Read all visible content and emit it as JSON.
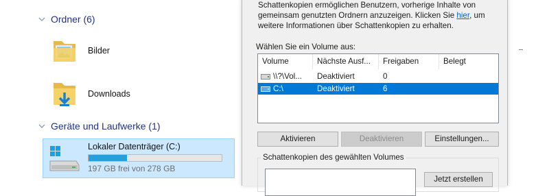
{
  "explorer": {
    "groups": [
      {
        "label": "Ordner (6)"
      },
      {
        "label": "Geräte und Laufwerke (1)"
      }
    ],
    "folders": [
      {
        "name": "Bilder",
        "icon": "pictures-folder-icon"
      },
      {
        "name": "Downloads",
        "icon": "downloads-folder-icon"
      }
    ],
    "drive": {
      "name": "Lokaler Datenträger (C:)",
      "free_text": "197 GB frei von 278 GB",
      "used_fraction": 0.29,
      "icon": "windows-drive-icon"
    }
  },
  "dialog": {
    "description_before_link": "Schattenkopien ermöglichen Benutzern, vorherige Inhalte von gemeinsam genutzten Ordnern anzuzeigen. Klicken Sie ",
    "link": "hier",
    "description_after_link": ", um weitere Informationen über Schattenkopien zu erhalten.",
    "volume_label": "Wählen Sie ein Volume aus:",
    "columns": [
      "Volume",
      "Nächste Ausf...",
      "Freigaben",
      "Belegt"
    ],
    "rows": [
      {
        "volume": "\\\\?\\Vol...",
        "next": "Deaktiviert",
        "shares": "0",
        "used": "",
        "selected": false
      },
      {
        "volume": "C:\\",
        "next": "Deaktiviert",
        "shares": "6",
        "used": "",
        "selected": true
      }
    ],
    "buttons": {
      "activate": "Aktivieren",
      "deactivate": "Deaktivieren",
      "settings": "Einstellungen..."
    },
    "snapshots_group": "Schattenkopien des gewählten Volumes",
    "create_now": "Jetzt erstellen"
  },
  "colors": {
    "accent": "#0078d7",
    "link": "#0066cc",
    "drive_bar": "#26a0da",
    "group_header": "#1e3287",
    "selection_bg": "#cce8ff"
  }
}
